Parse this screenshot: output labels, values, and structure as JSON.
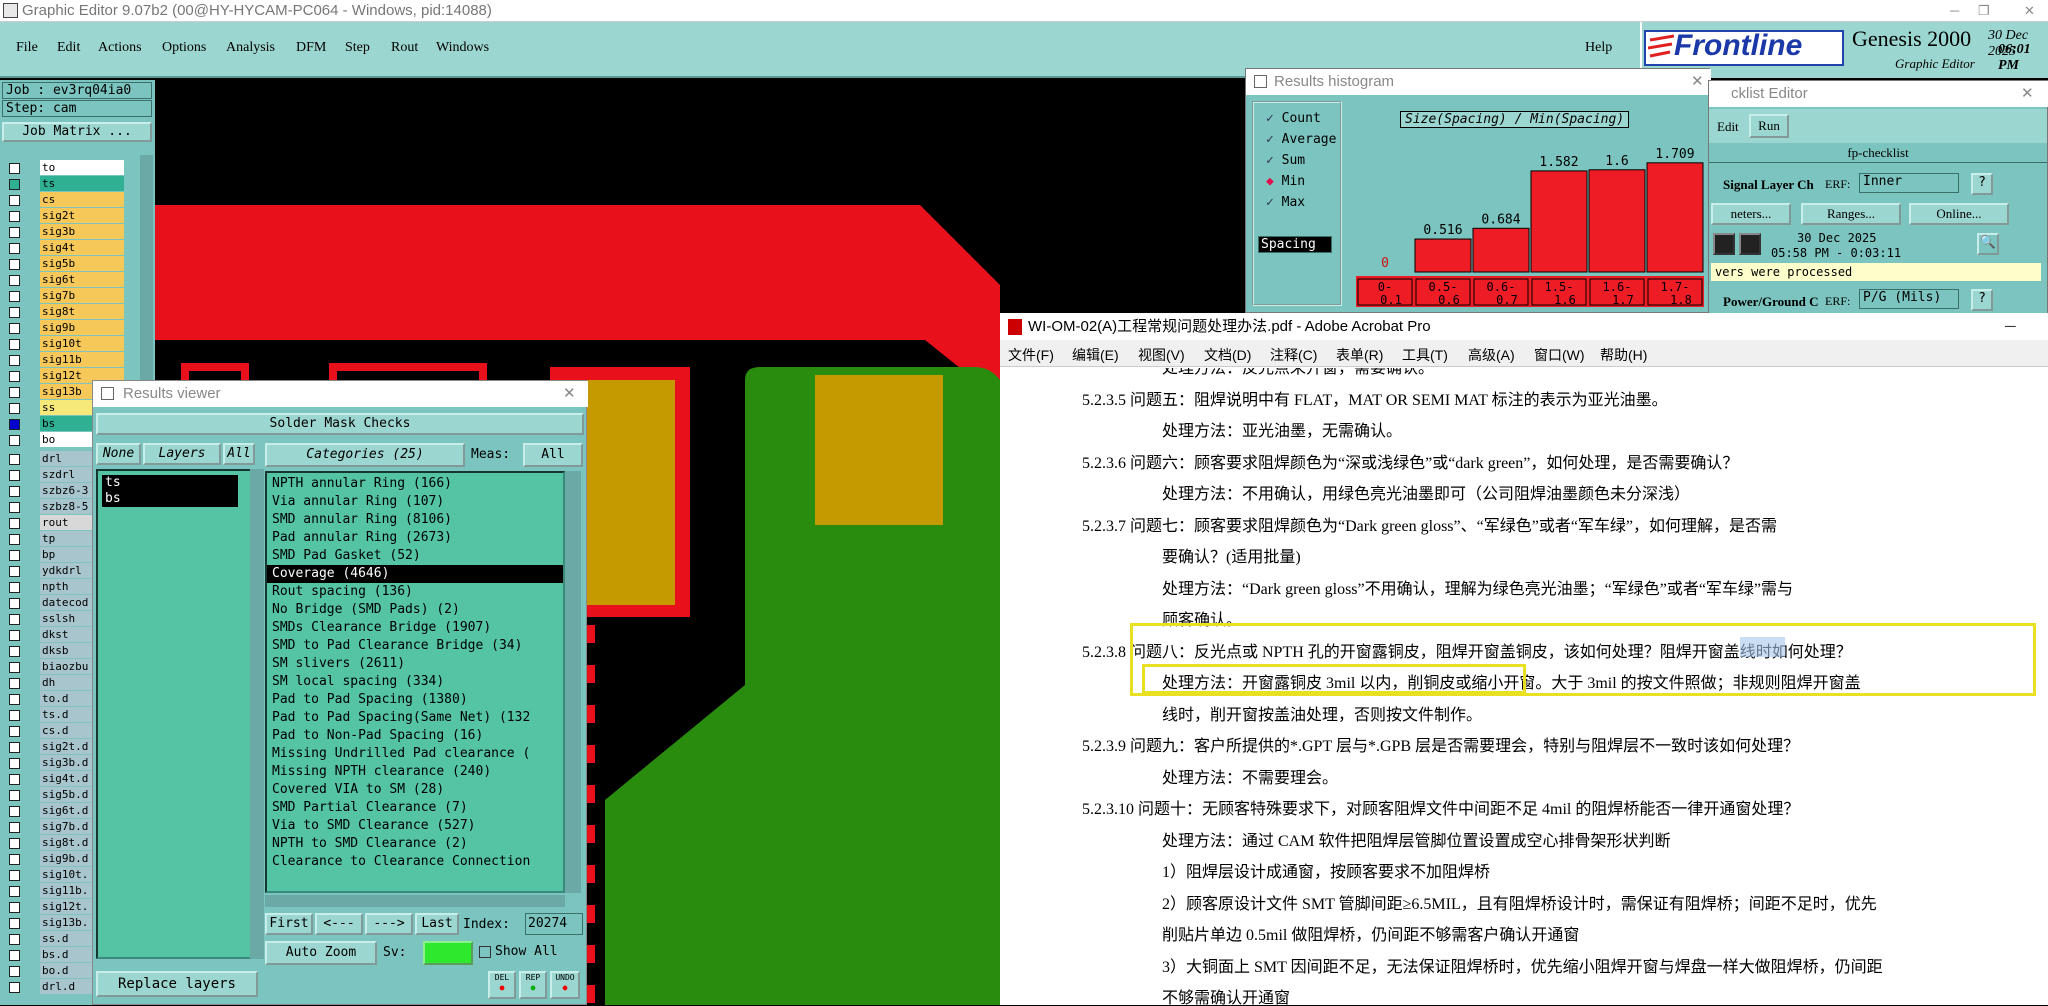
{
  "app": {
    "title": "Graphic Editor 9.07b2 (00@HY-HYCAM-PC064 - Windows, pid:14088)",
    "menu": [
      "File",
      "Edit",
      "Actions",
      "Options",
      "Analysis",
      "DFM",
      "Step",
      "Rout",
      "Windows"
    ],
    "help": "Help",
    "logo_text": "Frontline",
    "product": "Genesis 2000",
    "product_sub": "Graphic Editor",
    "date": "30 Dec 2025",
    "time": "06:01 PM"
  },
  "left": {
    "job": "Job : ev3rq04ia0",
    "step": "Step: cam",
    "job_matrix": "Job Matrix ...",
    "layers_top": [
      {
        "name": "to",
        "color": "#ffffff"
      },
      {
        "name": "ts",
        "color": "#2fb093"
      },
      {
        "name": "cs",
        "color": "#f6c85a"
      },
      {
        "name": "sig2t",
        "color": "#f6c85a"
      },
      {
        "name": "sig3b",
        "color": "#f6c85a"
      },
      {
        "name": "sig4t",
        "color": "#f6c85a"
      },
      {
        "name": "sig5b",
        "color": "#f6c85a"
      },
      {
        "name": "sig6t",
        "color": "#f6c85a"
      },
      {
        "name": "sig7b",
        "color": "#f6c85a"
      },
      {
        "name": "sig8t",
        "color": "#f6c85a"
      },
      {
        "name": "sig9b",
        "color": "#f6c85a"
      },
      {
        "name": "sig10t",
        "color": "#f6c85a"
      },
      {
        "name": "sig11b",
        "color": "#f6c85a"
      },
      {
        "name": "sig12t",
        "color": "#f6c85a"
      },
      {
        "name": "sig13b",
        "color": "#f6c85a"
      },
      {
        "name": "ss",
        "color": "#f6e97a"
      },
      {
        "name": "bs",
        "color": "#2fb093"
      },
      {
        "name": "bo",
        "color": "#ffffff"
      }
    ],
    "layers_bottom": [
      "drl",
      "szdrl",
      "szbz6-3",
      "szbz8-5",
      "rout",
      "tp",
      "bp",
      "ydkdrl",
      "npth",
      "datecod",
      "sslsh",
      "dkst",
      "dksb",
      "biaozbu",
      "dh",
      "to.d",
      "ts.d",
      "cs.d",
      "sig2t.d",
      "sig3b.d",
      "sig4t.d",
      "sig5b.d",
      "sig6t.d",
      "sig7b.d",
      "sig8t.d",
      "sig9b.d",
      "sig10t.",
      "sig11b.",
      "sig12t.",
      "sig13b.",
      "ss.d",
      "bs.d",
      "bo.d",
      "drl.d"
    ]
  },
  "results_viewer": {
    "title": "Results viewer",
    "header": "Solder Mask Checks",
    "none": "None",
    "layers": "Layers",
    "all": "All",
    "categories": "Categories (25)",
    "meas_label": "Meas:",
    "meas_value": "All",
    "layer_list": [
      "ts",
      "bs"
    ],
    "items": [
      "NPTH annular Ring (166)",
      "Via annular Ring (107)",
      "SMD annular Ring (8106)",
      "Pad annular Ring (2673)",
      "SMD Pad Gasket (52)",
      "Coverage (4646)",
      "Rout spacing (136)",
      "No Bridge (SMD Pads) (2)",
      "SMDs Clearance Bridge (1907)",
      "SMD to Pad Clearance Bridge (34)",
      "SM slivers (2611)",
      "SM local spacing (334)",
      "Pad to Pad Spacing (1380)",
      "Pad to Pad Spacing(Same Net) (132",
      "Pad to Non-Pad Spacing (16)",
      "Missing Undrilled Pad clearance (",
      "Missing NPTH clearance (240)",
      "Covered VIA to SM (28)",
      "SMD Partial Clearance (7)",
      "Via to SMD Clearance (527)",
      "NPTH to SMD Clearance (2)",
      "Clearance to Clearance Connection"
    ],
    "selected_index": 5,
    "first": "First",
    "prev": "<---",
    "next": "--->",
    "last": "Last",
    "index_label": "Index:",
    "index_value": "20274",
    "auto_zoom": "Auto Zoom",
    "sv": "Sv:",
    "show_all": "Show All",
    "replace_layers": "Replace layers",
    "del": "DEL",
    "rep": "REP",
    "undo": "UNDO"
  },
  "histogram": {
    "title": "Results histogram",
    "options": [
      {
        "label": "Count",
        "marker": "check"
      },
      {
        "label": "Average",
        "marker": "check"
      },
      {
        "label": "Sum",
        "marker": "check"
      },
      {
        "label": "Min",
        "marker": "diamond"
      },
      {
        "label": "Max",
        "marker": "check"
      }
    ],
    "mode": "Spacing",
    "chart_title": "Size(Spacing) / Min(Spacing)",
    "bar_color": "#ee1c25"
  },
  "chart_data": {
    "type": "bar",
    "title": "Size(Spacing) / Min(Spacing)",
    "categories": [
      "0-0.1",
      "0.5-0.6",
      "0.6-0.7",
      "1.5-1.6",
      "1.6-1.7",
      "1.7-1.8"
    ],
    "values": [
      0,
      0.516,
      0.684,
      1.582,
      1.6,
      1.709
    ],
    "labels": [
      "0",
      "0.516",
      "0.684",
      "1.582",
      "1.6",
      "1.709"
    ],
    "ylim": [
      0,
      1.8
    ]
  },
  "checklist": {
    "title": "cklist Editor",
    "edit": "Edit",
    "run": "Run",
    "name": "fp-checklist",
    "row1": "Signal Layer Ch",
    "erf": "ERF:",
    "erf1": "Inner",
    "q": "?",
    "params": "neters...",
    "ranges": "Ranges...",
    "online": "Online...",
    "date": "30 Dec 2025",
    "time": "05:58 PM - 0:03:11",
    "msg": "vers were processed",
    "row2": "Power/Ground C",
    "erf2": "P/G (Mils)"
  },
  "pdf": {
    "title": "WI-OM-02(A)工程常规问题处理办法.pdf - Adobe Acrobat Pro",
    "menu": [
      "文件(F)",
      "编辑(E)",
      "视图(V)",
      "文档(D)",
      "注释(C)",
      "表单(R)",
      "工具(T)",
      "高级(A)",
      "窗口(W)",
      "帮助(H)"
    ],
    "lines": [
      "处理方法：反光点未开窗，需要确认。",
      "5.2.3.5  问题五：阻焊说明中有 FLAT，MAT OR SEMI MAT 标注的表示为亚光油墨。",
      "处理方法：亚光油墨，无需确认。",
      "5.2.3.6  问题六：顾客要求阻焊颜色为“深或浅绿色”或“dark green”，如何处理，是否需要确认？",
      "处理方法：不用确认，用绿色亮光油墨即可（公司阻焊油墨颜色未分深浅）",
      "5.2.3.7  问题七：顾客要求阻焊颜色为“Dark green gloss”、“军绿色”或者“军车绿”，如何理解，是否需",
      "要确认？(适用批量)",
      "处理方法：“Dark green gloss”不用确认，理解为绿色亮光油墨；“军绿色”或者“军车绿”需与",
      "顾客确认。",
      "5.2.3.8  问题八：反光点或 NPTH 孔的开窗露铜皮，阻焊开窗盖铜皮，该如何处理？阻焊开窗盖线时如何处理？",
      "处理方法：开窗露铜皮 3mil 以内，削铜皮或缩小开窗。大于 3mil 的按文件照做；非规则阻焊开窗盖",
      "线时，削开窗按盖油处理，否则按文件制作。",
      "5.2.3.9  问题九：客户所提供的*.GPT 层与*.GPB 层是否需要理会，特别与阻焊层不一致时该如何处理？",
      "处理方法：不需要理会。",
      "5.2.3.10  问题十：无顾客特殊要求下，对顾客阻焊文件中间距不足 4mil 的阻焊桥能否一律开通窗处理？",
      "处理方法：通过 CAM 软件把阻焊层管脚位置设置成空心排骨架形状判断",
      "1）阻焊层设计成通窗，按顾客要求不加阻焊桥",
      "2）顾客原设计文件 SMT 管脚间距≥6.5MIL，且有阻焊桥设计时，需保证有阻焊桥；间距不足时，优先",
      "削贴片单边 0.5mil 做阻焊桥，仍间距不够需客户确认开通窗",
      "3）大铜面上 SMT 因间距不足，无法保证阻焊桥时，优先缩小阻焊开窗与焊盘一样大做阻焊桥，仍间距",
      "不够需确认开通窗"
    ]
  }
}
